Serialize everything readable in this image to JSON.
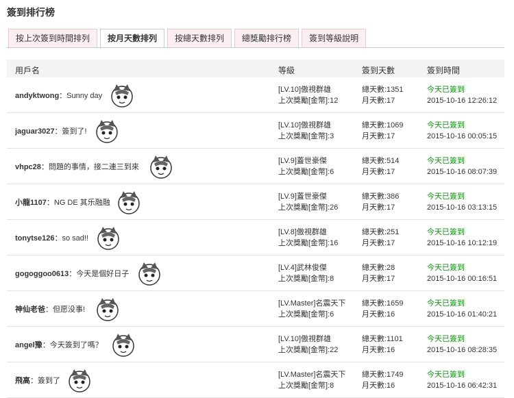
{
  "page_title": "簽到排行榜",
  "tabs": [
    {
      "label": "按上次簽到時間排列",
      "active": false
    },
    {
      "label": "按月天數排列",
      "active": true
    },
    {
      "label": "按總天數排列",
      "active": false
    },
    {
      "label": "總獎勵排行榜",
      "active": false
    },
    {
      "label": "簽到等級說明",
      "active": false
    }
  ],
  "columns": {
    "user": "用戶名",
    "level": "等級",
    "days": "簽到天數",
    "time": "簽到時間"
  },
  "rows": [
    {
      "user": "andyktwong",
      "message": "Sunny day",
      "level": "[LV.10]傲視群雄",
      "last_reward": "上次獎勵[金幣]:12",
      "total_days": "總天數:1351",
      "month_days": "月天數:17",
      "status": "今天已簽到",
      "datetime": "2015-10-16 12:26:12"
    },
    {
      "user": "jaguar3027",
      "message": "簽到了!",
      "level": "[LV.10]傲視群雄",
      "last_reward": "上次獎勵[金幣]:3",
      "total_days": "總天數:1069",
      "month_days": "月天數:17",
      "status": "今天已簽到",
      "datetime": "2015-10-16 00:05:15"
    },
    {
      "user": "vhpc28",
      "message": "問題的事情，接二連三到來",
      "level": "[LV.9]蓋世豪傑",
      "last_reward": "上次獎勵[金幣]:6",
      "total_days": "總天數:514",
      "month_days": "月天數:17",
      "status": "今天已簽到",
      "datetime": "2015-10-16 08:07:39"
    },
    {
      "user": "小龍1107",
      "message": "NG DE 其乐融融",
      "level": "[LV.9]蓋世豪傑",
      "last_reward": "上次獎勵[金幣]:26",
      "total_days": "總天數:386",
      "month_days": "月天數:17",
      "status": "今天已簽到",
      "datetime": "2015-10-16 03:13:15"
    },
    {
      "user": "tonytse126",
      "message": "so sad!!",
      "level": "[LV.8]傲視群雄",
      "last_reward": "上次獎勵[金幣]:16",
      "total_days": "總天數:251",
      "month_days": "月天數:17",
      "status": "今天已簽到",
      "datetime": "2015-10-16 10:12:19"
    },
    {
      "user": "gogoggoo0613",
      "message": "今天是個好日子",
      "level": "[LV.4]武林俊傑",
      "last_reward": "上次獎勵[金幣]:8",
      "total_days": "總天數:28",
      "month_days": "月天數:17",
      "status": "今天已簽到",
      "datetime": "2015-10-16 00:16:51"
    },
    {
      "user": "神仙老爸",
      "message": "但愿没事!",
      "level": "[LV.Master]名震天下",
      "last_reward": "上次獎勵[金幣]:6",
      "total_days": "總天數:1659",
      "month_days": "月天數:16",
      "status": "今天已簽到",
      "datetime": "2015-10-16 01:40:21"
    },
    {
      "user": "angel豫",
      "message": "今天簽到了嗎？",
      "level": "[LV.10]傲視群雄",
      "last_reward": "上次獎勵[金幣]:22",
      "total_days": "總天數:1101",
      "month_days": "月天數:16",
      "status": "今天已簽到",
      "datetime": "2015-10-16 08:28:35"
    },
    {
      "user": "飛高",
      "message": "簽到了",
      "level": "[LV.Master]名震天下",
      "last_reward": "上次獎勵[金幣]:8",
      "total_days": "總天數:1749",
      "month_days": "月天數:16",
      "status": "今天已簽到",
      "datetime": "2015-10-16 06:42:31"
    }
  ]
}
